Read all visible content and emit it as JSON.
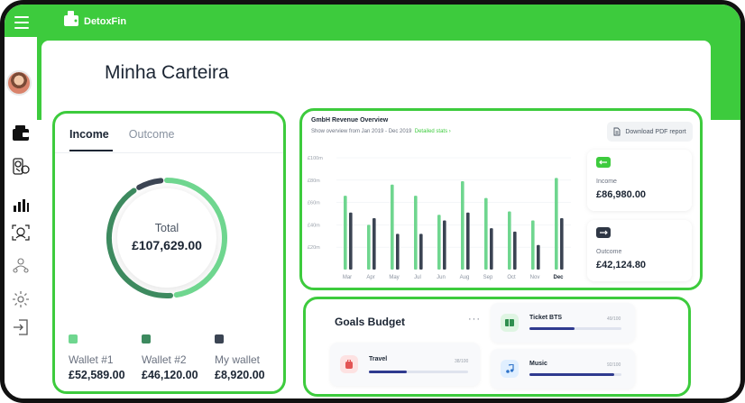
{
  "app": {
    "brand": "DetoxFin",
    "brand_color": "#3dcb3d"
  },
  "sidebar": {
    "items": [
      {
        "icon": "wallet-icon"
      },
      {
        "icon": "coin-exchange-icon"
      },
      {
        "icon": "bar-chart-icon"
      },
      {
        "icon": "face-scan-icon"
      },
      {
        "icon": "people-icon"
      },
      {
        "icon": "gear-icon"
      },
      {
        "icon": "logout-icon"
      }
    ]
  },
  "page": {
    "title": "Minha Carteira"
  },
  "wallet": {
    "tabs": [
      "Income",
      "Outcome"
    ],
    "active_tab": "Income",
    "total_label": "Total",
    "total_value": "£107,629.00",
    "wallets": [
      {
        "name": "Wallet #1",
        "value": "£52,589.00",
        "color": "#6fd68f",
        "share": 0.49
      },
      {
        "name": "Wallet #2",
        "value": "£46,120.00",
        "color": "#3d8a5f",
        "share": 0.43
      },
      {
        "name": "My wallet",
        "value": "£8,920.00",
        "color": "#3b4453",
        "share": 0.08
      }
    ]
  },
  "revenue": {
    "title": "GmbH Revenue Overview",
    "subtitle": "Show overview from Jan 2019 - Dec 2019",
    "detail_link": "Detailed stats ›",
    "download_label": "Download PDF report",
    "income": {
      "label": "Income",
      "value": "£86,980.00"
    },
    "outcome": {
      "label": "Outcome",
      "value": "£42,124.80"
    }
  },
  "chart_data": {
    "type": "bar",
    "categories": [
      "Mar",
      "Apr",
      "May",
      "Jul",
      "Jun",
      "Aug",
      "Sep",
      "Oct",
      "Nov",
      "Dec"
    ],
    "y_ticks": [
      "£100m",
      "£80m",
      "£60m",
      "£40m",
      "£20m"
    ],
    "ylim": [
      0,
      100
    ],
    "series": [
      {
        "color": "#6fd68f",
        "values": [
          66,
          40,
          76,
          66,
          49,
          79,
          64,
          52,
          44,
          82
        ]
      },
      {
        "color": "#3b4453",
        "values": [
          51,
          46,
          32,
          32,
          44,
          51,
          37,
          34,
          22,
          46
        ]
      }
    ],
    "grid": true
  },
  "goals": {
    "title": "Goals Budget",
    "more": "···",
    "items": [
      {
        "name": "Ticket BTS",
        "count": "49/100",
        "progress": 0.49,
        "icon": "ticket-icon",
        "icon_bg": "#dff5e3"
      },
      {
        "name": "Travel",
        "count": "38/100",
        "progress": 0.38,
        "icon": "travel-bag-icon",
        "icon_bg": "#fde2e2"
      },
      {
        "name": "Music",
        "count": "92/100",
        "progress": 0.92,
        "icon": "music-note-icon",
        "icon_bg": "#e0efff"
      }
    ]
  }
}
